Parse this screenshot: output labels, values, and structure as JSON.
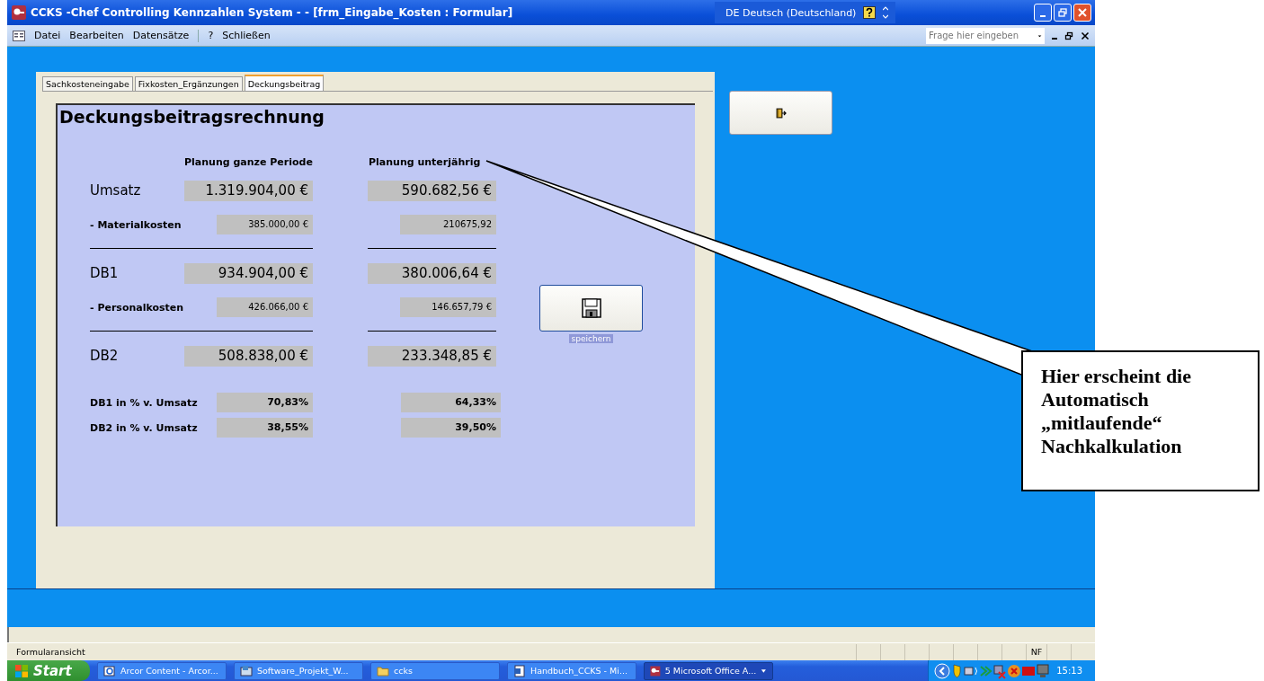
{
  "window": {
    "title": "CCKS -Chef Controlling Kennzahlen System - - [frm_Eingabe_Kosten : Formular]",
    "language_bar": "DE Deutsch (Deutschland)"
  },
  "menu": {
    "items": [
      "Datei",
      "Bearbeiten",
      "Datensätze",
      "?",
      "Schließen"
    ],
    "help_search": {
      "placeholder": "Frage hier eingeben"
    }
  },
  "tabs": [
    {
      "label": "Sachkosteneingabe",
      "selected": false
    },
    {
      "label": "Fixkosten_Ergänzungen",
      "selected": false
    },
    {
      "label": "Deckungsbeitrag",
      "selected": true
    }
  ],
  "form": {
    "title": "Deckungsbeitragsrechnung",
    "columns": [
      "Planung ganze Periode",
      "Planung unterjährig"
    ],
    "rows": [
      {
        "kind": "big",
        "label": "Umsatz",
        "values": [
          "1.319.904,00 €",
          "590.682,56 €"
        ],
        "rule_below": false
      },
      {
        "kind": "small",
        "label": "- Materialkosten",
        "values": [
          "385.000,00 €",
          "210675,92"
        ],
        "rule_below": true
      },
      {
        "kind": "big",
        "label": "DB1",
        "values": [
          "934.904,00 €",
          "380.006,64 €"
        ],
        "rule_below": false
      },
      {
        "kind": "small",
        "label": "- Personalkosten",
        "values": [
          "426.066,00 €",
          "146.657,79 €"
        ],
        "rule_below": true
      },
      {
        "kind": "big",
        "label": "DB2",
        "values": [
          "508.838,00 €",
          "233.348,85 €"
        ],
        "rule_below": false
      },
      {
        "kind": "percent",
        "label": "DB1 in % v. Umsatz",
        "values": [
          "70,83%",
          "64,33%"
        ],
        "rule_below": false
      },
      {
        "kind": "percent",
        "label": "DB2 in % v. Umsatz",
        "values": [
          "38,55%",
          "39,50%"
        ],
        "rule_below": false
      }
    ],
    "save_button": {
      "caption": "speichern"
    }
  },
  "callout": {
    "text": "Hier erscheint die Automatisch „mitlaufende“ Nachkalkulation"
  },
  "status_bar": {
    "mode": "Formularansicht",
    "indicator": "NF"
  },
  "taskbar": {
    "start": "Start",
    "items": [
      {
        "label": "Arcor Content - Arcor...",
        "kind": "browser",
        "selected": false
      },
      {
        "label": "Software_Projekt_W...",
        "kind": "app",
        "selected": false
      },
      {
        "label": "ccks",
        "kind": "folder",
        "selected": false
      },
      {
        "label": "Handbuch_CCKS - Mi...",
        "kind": "document",
        "selected": false
      },
      {
        "label": "5 Microsoft Office A...",
        "kind": "database",
        "selected": true
      }
    ],
    "clock": "15:13"
  }
}
